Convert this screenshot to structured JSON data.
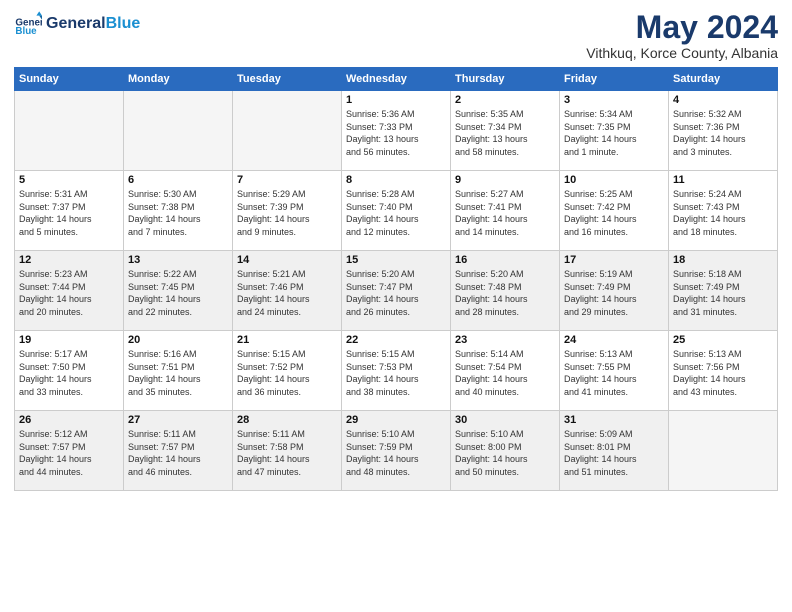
{
  "logo": {
    "line1": "General",
    "line2": "Blue"
  },
  "title": "May 2024",
  "location": "Vithkuq, Korce County, Albania",
  "weekdays": [
    "Sunday",
    "Monday",
    "Tuesday",
    "Wednesday",
    "Thursday",
    "Friday",
    "Saturday"
  ],
  "weeks": [
    [
      {
        "day": "",
        "info": "",
        "empty": true
      },
      {
        "day": "",
        "info": "",
        "empty": true
      },
      {
        "day": "",
        "info": "",
        "empty": true
      },
      {
        "day": "1",
        "info": "Sunrise: 5:36 AM\nSunset: 7:33 PM\nDaylight: 13 hours\nand 56 minutes."
      },
      {
        "day": "2",
        "info": "Sunrise: 5:35 AM\nSunset: 7:34 PM\nDaylight: 13 hours\nand 58 minutes."
      },
      {
        "day": "3",
        "info": "Sunrise: 5:34 AM\nSunset: 7:35 PM\nDaylight: 14 hours\nand 1 minute."
      },
      {
        "day": "4",
        "info": "Sunrise: 5:32 AM\nSunset: 7:36 PM\nDaylight: 14 hours\nand 3 minutes."
      }
    ],
    [
      {
        "day": "5",
        "info": "Sunrise: 5:31 AM\nSunset: 7:37 PM\nDaylight: 14 hours\nand 5 minutes."
      },
      {
        "day": "6",
        "info": "Sunrise: 5:30 AM\nSunset: 7:38 PM\nDaylight: 14 hours\nand 7 minutes."
      },
      {
        "day": "7",
        "info": "Sunrise: 5:29 AM\nSunset: 7:39 PM\nDaylight: 14 hours\nand 9 minutes."
      },
      {
        "day": "8",
        "info": "Sunrise: 5:28 AM\nSunset: 7:40 PM\nDaylight: 14 hours\nand 12 minutes."
      },
      {
        "day": "9",
        "info": "Sunrise: 5:27 AM\nSunset: 7:41 PM\nDaylight: 14 hours\nand 14 minutes."
      },
      {
        "day": "10",
        "info": "Sunrise: 5:25 AM\nSunset: 7:42 PM\nDaylight: 14 hours\nand 16 minutes."
      },
      {
        "day": "11",
        "info": "Sunrise: 5:24 AM\nSunset: 7:43 PM\nDaylight: 14 hours\nand 18 minutes."
      }
    ],
    [
      {
        "day": "12",
        "info": "Sunrise: 5:23 AM\nSunset: 7:44 PM\nDaylight: 14 hours\nand 20 minutes."
      },
      {
        "day": "13",
        "info": "Sunrise: 5:22 AM\nSunset: 7:45 PM\nDaylight: 14 hours\nand 22 minutes."
      },
      {
        "day": "14",
        "info": "Sunrise: 5:21 AM\nSunset: 7:46 PM\nDaylight: 14 hours\nand 24 minutes."
      },
      {
        "day": "15",
        "info": "Sunrise: 5:20 AM\nSunset: 7:47 PM\nDaylight: 14 hours\nand 26 minutes."
      },
      {
        "day": "16",
        "info": "Sunrise: 5:20 AM\nSunset: 7:48 PM\nDaylight: 14 hours\nand 28 minutes."
      },
      {
        "day": "17",
        "info": "Sunrise: 5:19 AM\nSunset: 7:49 PM\nDaylight: 14 hours\nand 29 minutes."
      },
      {
        "day": "18",
        "info": "Sunrise: 5:18 AM\nSunset: 7:49 PM\nDaylight: 14 hours\nand 31 minutes."
      }
    ],
    [
      {
        "day": "19",
        "info": "Sunrise: 5:17 AM\nSunset: 7:50 PM\nDaylight: 14 hours\nand 33 minutes."
      },
      {
        "day": "20",
        "info": "Sunrise: 5:16 AM\nSunset: 7:51 PM\nDaylight: 14 hours\nand 35 minutes."
      },
      {
        "day": "21",
        "info": "Sunrise: 5:15 AM\nSunset: 7:52 PM\nDaylight: 14 hours\nand 36 minutes."
      },
      {
        "day": "22",
        "info": "Sunrise: 5:15 AM\nSunset: 7:53 PM\nDaylight: 14 hours\nand 38 minutes."
      },
      {
        "day": "23",
        "info": "Sunrise: 5:14 AM\nSunset: 7:54 PM\nDaylight: 14 hours\nand 40 minutes."
      },
      {
        "day": "24",
        "info": "Sunrise: 5:13 AM\nSunset: 7:55 PM\nDaylight: 14 hours\nand 41 minutes."
      },
      {
        "day": "25",
        "info": "Sunrise: 5:13 AM\nSunset: 7:56 PM\nDaylight: 14 hours\nand 43 minutes."
      }
    ],
    [
      {
        "day": "26",
        "info": "Sunrise: 5:12 AM\nSunset: 7:57 PM\nDaylight: 14 hours\nand 44 minutes."
      },
      {
        "day": "27",
        "info": "Sunrise: 5:11 AM\nSunset: 7:57 PM\nDaylight: 14 hours\nand 46 minutes."
      },
      {
        "day": "28",
        "info": "Sunrise: 5:11 AM\nSunset: 7:58 PM\nDaylight: 14 hours\nand 47 minutes."
      },
      {
        "day": "29",
        "info": "Sunrise: 5:10 AM\nSunset: 7:59 PM\nDaylight: 14 hours\nand 48 minutes."
      },
      {
        "day": "30",
        "info": "Sunrise: 5:10 AM\nSunset: 8:00 PM\nDaylight: 14 hours\nand 50 minutes."
      },
      {
        "day": "31",
        "info": "Sunrise: 5:09 AM\nSunset: 8:01 PM\nDaylight: 14 hours\nand 51 minutes."
      },
      {
        "day": "",
        "info": "",
        "empty": true
      }
    ]
  ]
}
